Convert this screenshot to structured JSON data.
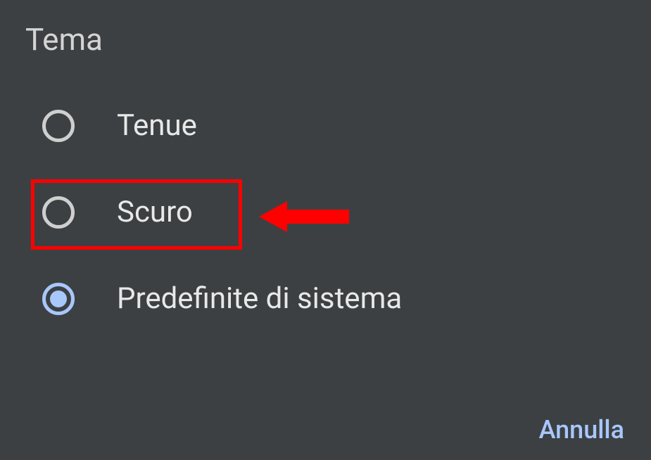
{
  "dialog": {
    "title": "Tema",
    "options": [
      {
        "label": "Tenue",
        "selected": false
      },
      {
        "label": "Scuro",
        "selected": false
      },
      {
        "label": "Predefinite di sistema",
        "selected": true
      }
    ],
    "cancel_label": "Annulla"
  },
  "annotation": {
    "highlight_color": "#ff0000",
    "arrow_color": "#ff0000"
  }
}
